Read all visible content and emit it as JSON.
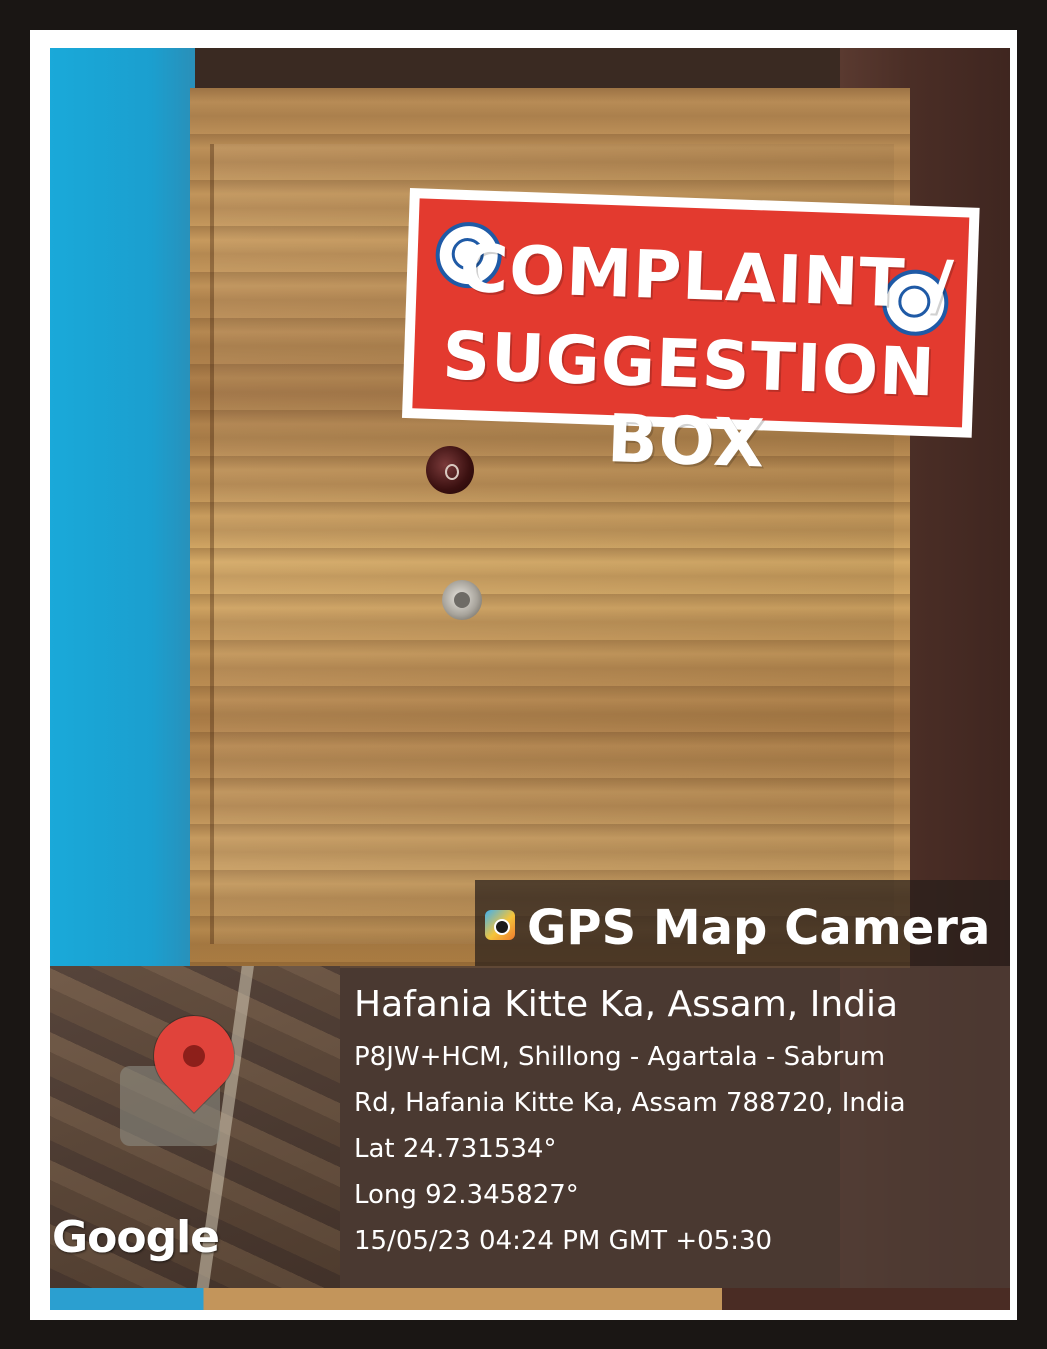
{
  "sign": {
    "line1": "COMPLAINT /",
    "line2": "SUGGESTION BOX"
  },
  "overlay": {
    "app_name": "GPS Map Camera",
    "app_icon": "camera-app-icon",
    "map_pin_icon": "location-pin-icon",
    "map_brand": "Google",
    "place": "Hafania Kitte Ka, Assam, India",
    "address_line1": "P8JW+HCM, Shillong - Agartala - Sabrum",
    "address_line2": "Rd, Hafania Kitte Ka, Assam 788720, India",
    "latitude": "Lat 24.731534°",
    "longitude": "Long 92.345827°",
    "timestamp": "15/05/23 04:24 PM GMT +05:30"
  },
  "colors": {
    "sign_red": "#e33a2f",
    "pin_red": "#e0433b",
    "wall_blue": "#1aa9d9"
  }
}
